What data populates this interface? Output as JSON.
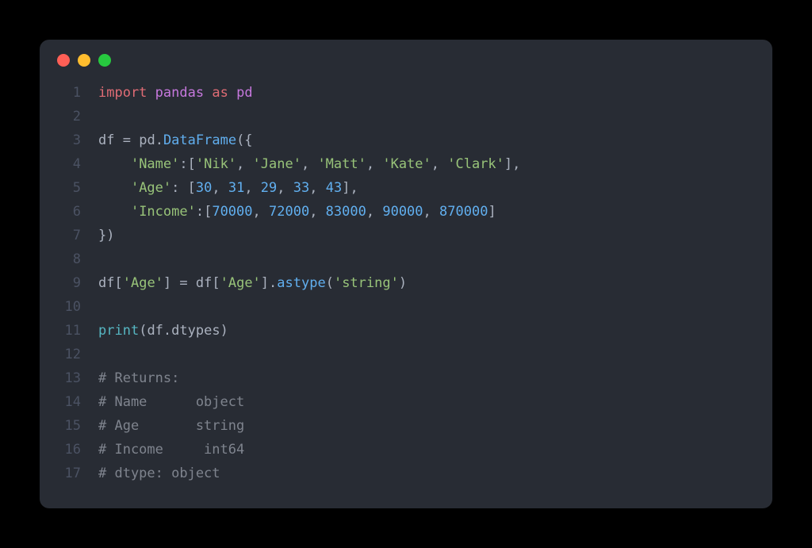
{
  "window": {
    "titlebar": {
      "dots": [
        "red",
        "yellow",
        "green"
      ]
    }
  },
  "colors": {
    "background": "#282c34",
    "keyword_red": "#e06c75",
    "module_purple": "#c678dd",
    "number_blue": "#61afef",
    "string_green": "#98c379",
    "method_blue": "#61afef",
    "builtin_teal": "#56b6c2",
    "comment_gray": "#7f848e",
    "text": "#abb2bf",
    "lineno": "#4b5263"
  },
  "code": {
    "line_count": 17,
    "lines": {
      "1": {
        "tokens": [
          {
            "c": "kw-import",
            "t": "import"
          },
          {
            "c": "",
            "t": " "
          },
          {
            "c": "module",
            "t": "pandas"
          },
          {
            "c": "",
            "t": " "
          },
          {
            "c": "kw-as",
            "t": "as"
          },
          {
            "c": "",
            "t": " "
          },
          {
            "c": "module",
            "t": "pd"
          }
        ]
      },
      "2": {
        "tokens": []
      },
      "3": {
        "tokens": [
          {
            "c": "ident",
            "t": "df "
          },
          {
            "c": "punct",
            "t": "= "
          },
          {
            "c": "ident",
            "t": "pd"
          },
          {
            "c": "punct",
            "t": "."
          },
          {
            "c": "method",
            "t": "DataFrame"
          },
          {
            "c": "punct",
            "t": "({"
          }
        ]
      },
      "4": {
        "tokens": [
          {
            "c": "",
            "t": "    "
          },
          {
            "c": "str",
            "t": "'Name'"
          },
          {
            "c": "punct",
            "t": ":["
          },
          {
            "c": "str",
            "t": "'Nik'"
          },
          {
            "c": "punct",
            "t": ", "
          },
          {
            "c": "str",
            "t": "'Jane'"
          },
          {
            "c": "punct",
            "t": ", "
          },
          {
            "c": "str",
            "t": "'Matt'"
          },
          {
            "c": "punct",
            "t": ", "
          },
          {
            "c": "str",
            "t": "'Kate'"
          },
          {
            "c": "punct",
            "t": ", "
          },
          {
            "c": "str",
            "t": "'Clark'"
          },
          {
            "c": "punct",
            "t": "],"
          }
        ]
      },
      "5": {
        "tokens": [
          {
            "c": "",
            "t": "    "
          },
          {
            "c": "str",
            "t": "'Age'"
          },
          {
            "c": "punct",
            "t": ": ["
          },
          {
            "c": "num",
            "t": "30"
          },
          {
            "c": "punct",
            "t": ", "
          },
          {
            "c": "num",
            "t": "31"
          },
          {
            "c": "punct",
            "t": ", "
          },
          {
            "c": "num",
            "t": "29"
          },
          {
            "c": "punct",
            "t": ", "
          },
          {
            "c": "num",
            "t": "33"
          },
          {
            "c": "punct",
            "t": ", "
          },
          {
            "c": "num",
            "t": "43"
          },
          {
            "c": "punct",
            "t": "],"
          }
        ]
      },
      "6": {
        "tokens": [
          {
            "c": "",
            "t": "    "
          },
          {
            "c": "str",
            "t": "'Income'"
          },
          {
            "c": "punct",
            "t": ":["
          },
          {
            "c": "num",
            "t": "70000"
          },
          {
            "c": "punct",
            "t": ", "
          },
          {
            "c": "num",
            "t": "72000"
          },
          {
            "c": "punct",
            "t": ", "
          },
          {
            "c": "num",
            "t": "83000"
          },
          {
            "c": "punct",
            "t": ", "
          },
          {
            "c": "num",
            "t": "90000"
          },
          {
            "c": "punct",
            "t": ", "
          },
          {
            "c": "num",
            "t": "870000"
          },
          {
            "c": "punct",
            "t": "]"
          }
        ]
      },
      "7": {
        "tokens": [
          {
            "c": "punct",
            "t": "})"
          }
        ]
      },
      "8": {
        "tokens": []
      },
      "9": {
        "tokens": [
          {
            "c": "ident",
            "t": "df"
          },
          {
            "c": "punct",
            "t": "["
          },
          {
            "c": "str",
            "t": "'Age'"
          },
          {
            "c": "punct",
            "t": "] = "
          },
          {
            "c": "ident",
            "t": "df"
          },
          {
            "c": "punct",
            "t": "["
          },
          {
            "c": "str",
            "t": "'Age'"
          },
          {
            "c": "punct",
            "t": "]."
          },
          {
            "c": "method",
            "t": "astype"
          },
          {
            "c": "punct",
            "t": "("
          },
          {
            "c": "str",
            "t": "'string'"
          },
          {
            "c": "punct",
            "t": ")"
          }
        ]
      },
      "10": {
        "tokens": []
      },
      "11": {
        "tokens": [
          {
            "c": "builtin",
            "t": "print"
          },
          {
            "c": "punct",
            "t": "("
          },
          {
            "c": "ident",
            "t": "df"
          },
          {
            "c": "punct",
            "t": "."
          },
          {
            "c": "ident",
            "t": "dtypes"
          },
          {
            "c": "punct",
            "t": ")"
          }
        ]
      },
      "12": {
        "tokens": []
      },
      "13": {
        "tokens": [
          {
            "c": "comment",
            "t": "# Returns:"
          }
        ]
      },
      "14": {
        "tokens": [
          {
            "c": "comment",
            "t": "# Name      object"
          }
        ]
      },
      "15": {
        "tokens": [
          {
            "c": "comment",
            "t": "# Age       string"
          }
        ]
      },
      "16": {
        "tokens": [
          {
            "c": "comment",
            "t": "# Income     int64"
          }
        ]
      },
      "17": {
        "tokens": [
          {
            "c": "comment",
            "t": "# dtype: object"
          }
        ]
      }
    }
  }
}
